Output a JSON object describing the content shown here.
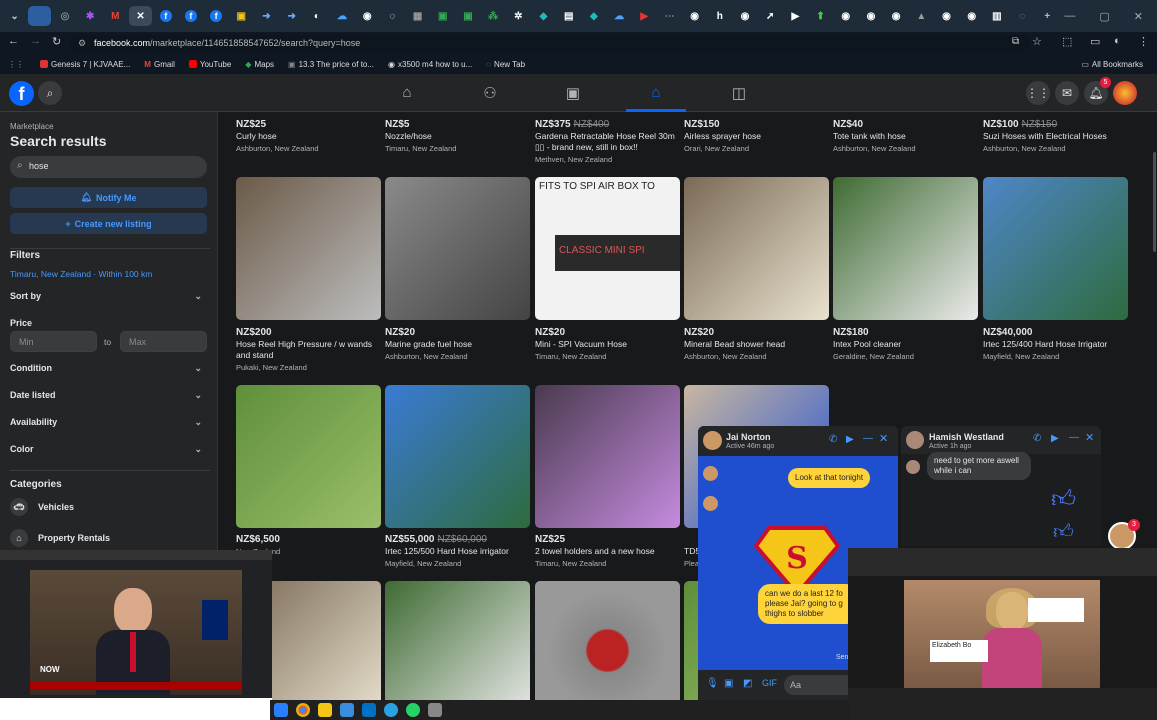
{
  "browser": {
    "url_host": "facebook.com",
    "url_path": "/marketplace/114651858547652/search?query=hose",
    "bookmarks": [
      "Genesis 7 | KJVAAE...",
      "Gmail",
      "YouTube",
      "Maps",
      "13.3 The price of to...",
      "x3500 m4 how to u...",
      "New Tab"
    ],
    "all_bookmarks": "All Bookmarks"
  },
  "sidebar": {
    "crumb": "Marketplace",
    "title": "Search results",
    "search_value": "hose",
    "notify": "Notify Me",
    "create": "Create new listing",
    "filters_label": "Filters",
    "location": "Timaru, New Zealand · Within 100 km",
    "sort_by": "Sort by",
    "price_label": "Price",
    "min_placeholder": "Min",
    "to": "to",
    "max_placeholder": "Max",
    "condition": "Condition",
    "date_listed": "Date listed",
    "availability": "Availability",
    "color": "Color",
    "categories": "Categories",
    "cat1": "Vehicles",
    "cat2": "Property Rentals"
  },
  "listings_top": [
    {
      "price": "NZ$25",
      "old": "",
      "title": "Curly hose",
      "loc": "Ashburton, New Zealand"
    },
    {
      "price": "NZ$5",
      "old": "",
      "title": "Nozzle/hose",
      "loc": "Timaru, New Zealand"
    },
    {
      "price": "NZ$375",
      "old": "NZ$400",
      "title": "Gardena Retractable Hose Reel 30m ▯▯ - brand new, still in box!!",
      "loc": "Methven, New Zealand"
    },
    {
      "price": "NZ$150",
      "old": "",
      "title": "Airless sprayer hose",
      "loc": "Orari, New Zealand"
    },
    {
      "price": "NZ$40",
      "old": "",
      "title": "Tote tank with hose",
      "loc": "Ashburton, New Zealand"
    },
    {
      "price": "NZ$100",
      "old": "NZ$150",
      "title": "Suzi Hoses with Electrical Hoses",
      "loc": "Ashburton, New Zealand"
    }
  ],
  "listings_mid": [
    {
      "price": "NZ$200",
      "old": "",
      "title": "Hose Reel High Pressure / w wands and stand",
      "loc": "Pukaki, New Zealand"
    },
    {
      "price": "NZ$20",
      "old": "",
      "title": "Marine grade fuel hose",
      "loc": "Ashburton, New Zealand"
    },
    {
      "price": "NZ$20",
      "old": "",
      "title": "Mini - SPI Vacuum Hose",
      "loc": "Timaru, New Zealand"
    },
    {
      "price": "NZ$20",
      "old": "",
      "title": "Mineral Bead shower head",
      "loc": "Ashburton, New Zealand"
    },
    {
      "price": "NZ$180",
      "old": "",
      "title": "Intex Pool cleaner",
      "loc": "Geraldine, New Zealand"
    },
    {
      "price": "NZ$40,000",
      "old": "",
      "title": "Irtec 125/400 Hard Hose Irrigator",
      "loc": "Mayfield, New Zealand"
    }
  ],
  "listings_low": [
    {
      "price": "NZ$6,500",
      "old": "",
      "title": "",
      "loc": "New Zealand"
    },
    {
      "price": "NZ$55,000",
      "old": "NZ$60,000",
      "title": "Irtec 125/500 Hard Hose irrigator",
      "loc": "Mayfield, New Zealand"
    },
    {
      "price": "NZ$25",
      "old": "",
      "title": "2 towel holders and a new hose",
      "loc": "Timaru, New Zealand"
    },
    {
      "price": "",
      "old": "",
      "title": "TD5",
      "loc": "Plea"
    }
  ],
  "spi_image_text": "FITS TO SPI AIR BOX TO",
  "spi_image_text2": "CLASSIC MINI SPI",
  "chat1": {
    "name": "Jai Norton",
    "status": "Active 46m ago",
    "msg1": "Look at that tonight",
    "msg2": "can we do a last 12 fo please Jai? going to g thighs to slobber",
    "sent": "Sent",
    "input_placeholder": "Aa"
  },
  "chat2": {
    "name": "Hamish Westland",
    "status": "Active 1h ago",
    "msg": "need to get more aswell while i can"
  },
  "video_left": {
    "caption": "NOW"
  },
  "video_right": {
    "lower_third": "Elizabeth Bo"
  },
  "colors": {
    "fb_blue": "#0866ff",
    "bg": "#18191a",
    "panel": "#242526",
    "accent_text": "#4599ff"
  }
}
